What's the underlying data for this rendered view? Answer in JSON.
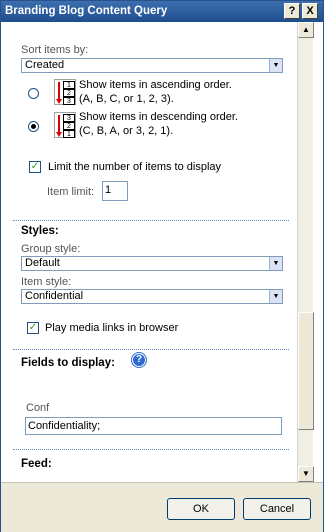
{
  "window": {
    "title": "Branding Blog Content Query",
    "help_glyph": "?",
    "close_glyph": "X"
  },
  "query": {
    "sort_label": "Sort items by:",
    "sort_value": "Created",
    "asc_text_1": "Show items in ascending order.",
    "asc_text_2": "(A, B, C, or 1, 2, 3).",
    "desc_text_1": "Show items in descending order.",
    "desc_text_2": "(C, B, A, or 3, 2, 1).",
    "asc_icon_nums": [
      "1",
      "2",
      "3"
    ],
    "desc_icon_nums": [
      "3",
      "2",
      "1"
    ],
    "selected_order": "descending",
    "limit_label": "Limit the number of items to display",
    "limit_checked": true,
    "item_limit_label": "Item limit:",
    "item_limit_value": "1"
  },
  "styles": {
    "heading": "Styles:",
    "group_label": "Group style:",
    "group_value": "Default",
    "item_label": "Item style:",
    "item_value": "Confidential",
    "play_media_label": "Play media links in browser",
    "play_media_checked": true
  },
  "fields": {
    "heading": "Fields to display:",
    "help_glyph": "?",
    "conf_label": "Conf",
    "conf_value": "Confidentiality;"
  },
  "feed": {
    "heading": "Feed:"
  },
  "footer": {
    "ok_label": "OK",
    "cancel_label": "Cancel"
  },
  "colors": {
    "titlebar": "#2a5a9c",
    "section_divider": "#6a86c4",
    "check_mark": "#21a121",
    "sort_arrow": "#dd0000"
  }
}
